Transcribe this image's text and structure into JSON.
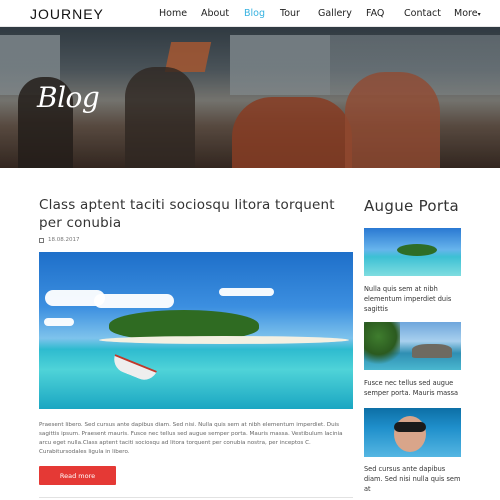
{
  "header": {
    "logo": "JOURNEY",
    "nav": [
      "Home",
      "About",
      "Blog",
      "Tour",
      "Gallery",
      "FAQ",
      "Contact",
      "More"
    ],
    "active_nav": "Blog",
    "accent_color": "#36b2e0"
  },
  "hero": {
    "title": "Blog"
  },
  "post": {
    "title": "Class aptent taciti sociosqu litora torquent per conubia",
    "date": "18.08.2017",
    "excerpt": "Praesent libero. Sed cursus ante dapibus diam. Sed nisi. Nulla quis sem at nibh elementum imperdiet. Duis sagittis ipsum. Praesent mauris. Fusce nec tellus sed augue semper porta. Mauris massa. Vestibulum lacinia arcu eget nulla.Class aptent taciti sociosqu ad litora torquent per conubia nostra, per inceptos C. Curabitursodales ligula in libero.",
    "read_more": "Read more",
    "button_color": "#e53935"
  },
  "sidebar": {
    "title": "Augue Porta",
    "items": [
      {
        "text": "Nulla quis sem at nibh elementum imperdiet duis sagittis"
      },
      {
        "text": "Fusce nec tellus sed augue semper porta. Mauris massa"
      },
      {
        "text": "Sed cursus ante dapibus diam. Sed nisi nulla quis sem at"
      }
    ]
  }
}
